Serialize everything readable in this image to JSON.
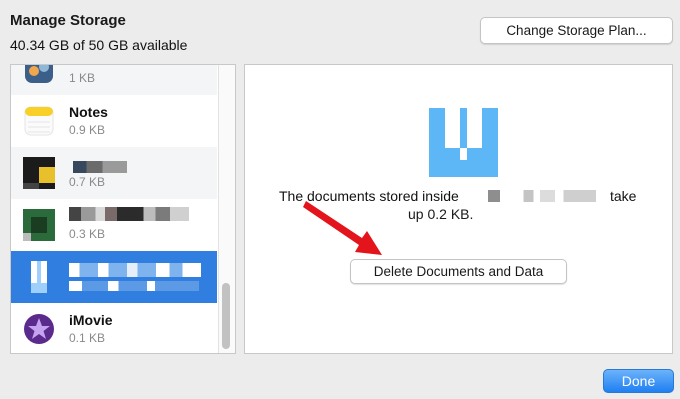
{
  "header": {
    "title": "Manage Storage",
    "available": "40.34 GB of 50 GB available",
    "change_plan_label": "Change Storage Plan..."
  },
  "apps": [
    {
      "name": "",
      "size": "1 KB"
    },
    {
      "name": "Notes",
      "size": "0.9 KB"
    },
    {
      "name": "",
      "size": "0.7 KB"
    },
    {
      "name": "",
      "size": "0.3 KB"
    },
    {
      "name": "",
      "size": ""
    },
    {
      "name": "iMovie",
      "size": "0.1 KB"
    }
  ],
  "detail": {
    "message_prefix": "The documents stored inside",
    "message_suffix": "take",
    "message_line2": "up 0.2 KB.",
    "delete_label": "Delete Documents and Data"
  },
  "footer": {
    "done_label": "Done"
  },
  "colors": {
    "selection": "#2f7ee0",
    "accent": "#1f7ff2",
    "arrow": "#e3141b"
  }
}
